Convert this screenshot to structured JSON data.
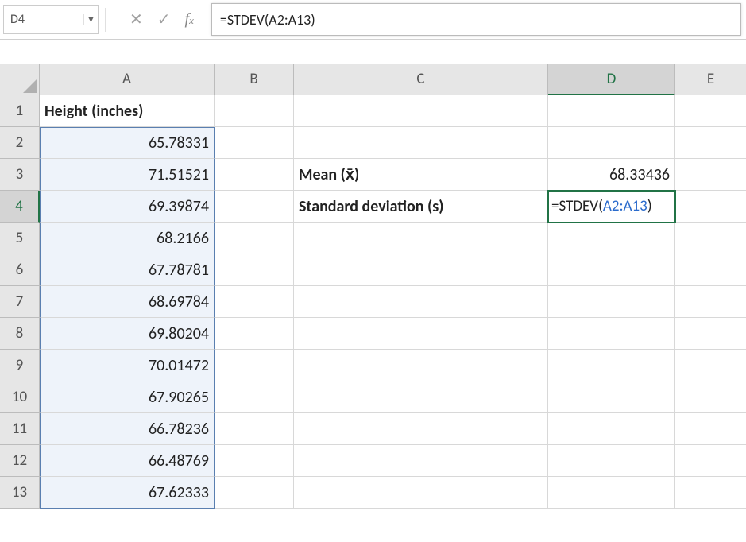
{
  "nameBox": "D4",
  "formulaBar": "=STDEV(A2:A13)",
  "columns": [
    "A",
    "B",
    "C",
    "D",
    "E"
  ],
  "rows": [
    "1",
    "2",
    "3",
    "4",
    "5",
    "6",
    "7",
    "8",
    "9",
    "10",
    "11",
    "12",
    "13"
  ],
  "header_A1": "Height (inches)",
  "colA": {
    "r2": "65.78331",
    "r3": "71.51521",
    "r4": "69.39874",
    "r5": "68.2166",
    "r6": "67.78781",
    "r7": "68.69784",
    "r8": "69.80204",
    "r9": "70.01472",
    "r10": "67.90265",
    "r11": "66.78236",
    "r12": "66.48769",
    "r13": "67.62333"
  },
  "labels": {
    "meanLabel": "Mean (x̄)",
    "sdLabel": "Standard deviation (s)"
  },
  "values": {
    "mean": "68.33436",
    "sdFormulaPrefix": "=STDEV(",
    "sdFormulaRef": "A2:A13",
    "sdFormulaSuffix": ")"
  },
  "activeColumn": "D",
  "activeRow": "4"
}
